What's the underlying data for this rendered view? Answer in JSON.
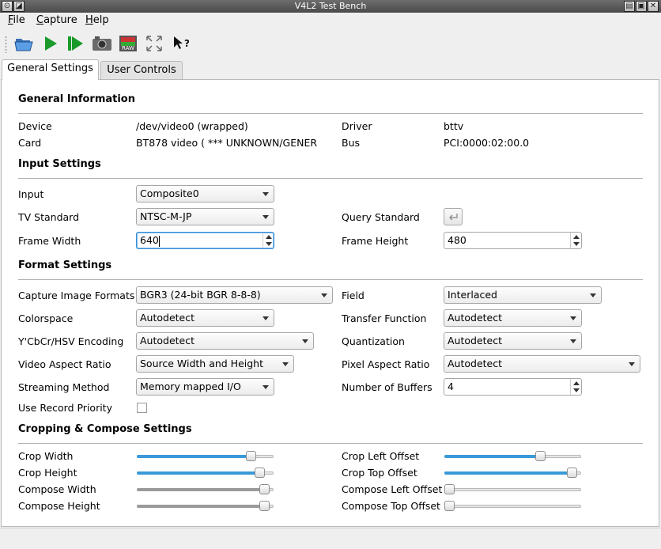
{
  "window": {
    "title": "V4L2 Test Bench"
  },
  "menu": {
    "items": [
      {
        "label": "File"
      },
      {
        "label": "Capture"
      },
      {
        "label": "Help"
      }
    ]
  },
  "toolbar": {
    "icons": [
      "open-folder-icon",
      "play-icon",
      "step-play-icon",
      "camera-icon",
      "raw-icon",
      "fullscreen-icon",
      "whats-this-icon"
    ]
  },
  "tabs": [
    {
      "label": "General Settings",
      "active": true
    },
    {
      "label": "User Controls",
      "active": false
    }
  ],
  "general": {
    "heading": "General Information",
    "device_label": "Device",
    "device_value": "/dev/video0 (wrapped)",
    "driver_label": "Driver",
    "driver_value": "bttv",
    "card_label": "Card",
    "card_value": "BT878 video ( *** UNKNOWN/GENER",
    "bus_label": "Bus",
    "bus_value": "PCI:0000:02:00.0"
  },
  "input": {
    "heading": "Input Settings",
    "input_label": "Input",
    "input_value": "Composite0",
    "tv_label": "TV Standard",
    "tv_value": "NTSC-M-JP",
    "query_label": "Query Standard",
    "fw_label": "Frame Width",
    "fw_value": "640",
    "fh_label": "Frame Height",
    "fh_value": "480"
  },
  "format": {
    "heading": "Format Settings",
    "cif_label": "Capture Image Formats",
    "cif_value": "BGR3 (24-bit BGR 8-8-8)",
    "field_label": "Field",
    "field_value": "Interlaced",
    "cs_label": "Colorspace",
    "cs_value": "Autodetect",
    "tf_label": "Transfer Function",
    "tf_value": "Autodetect",
    "ycc_label": "Y'CbCr/HSV Encoding",
    "ycc_value": "Autodetect",
    "quant_label": "Quantization",
    "quant_value": "Autodetect",
    "var_label": "Video Aspect Ratio",
    "var_value": "Source Width and Height",
    "par_label": "Pixel Aspect Ratio",
    "par_value": "Autodetect",
    "sm_label": "Streaming Method",
    "sm_value": "Memory mapped I/O",
    "nb_label": "Number of Buffers",
    "nb_value": "4",
    "urp_label": "Use Record Priority",
    "urp_checked": false
  },
  "crop": {
    "heading": "Cropping & Compose Settings",
    "sliders": [
      {
        "label": "Crop Width",
        "level": 0.86,
        "active": true
      },
      {
        "label": "Crop Height",
        "level": 0.93,
        "active": true
      },
      {
        "label": "Compose Width",
        "level": 0.97,
        "active": false
      },
      {
        "label": "Compose Height",
        "level": 0.97,
        "active": false
      },
      {
        "label": "Crop Left Offset",
        "level": 0.72,
        "active": true
      },
      {
        "label": "Crop Top Offset",
        "level": 0.97,
        "active": true
      },
      {
        "label": "Compose Left Offset",
        "level": 0.0,
        "active": false
      },
      {
        "label": "Compose Top Offset",
        "level": 0.0,
        "active": false
      }
    ]
  },
  "colors": {
    "accent": "#3a9ad9",
    "inactive_fill": "#9a9a9a"
  }
}
